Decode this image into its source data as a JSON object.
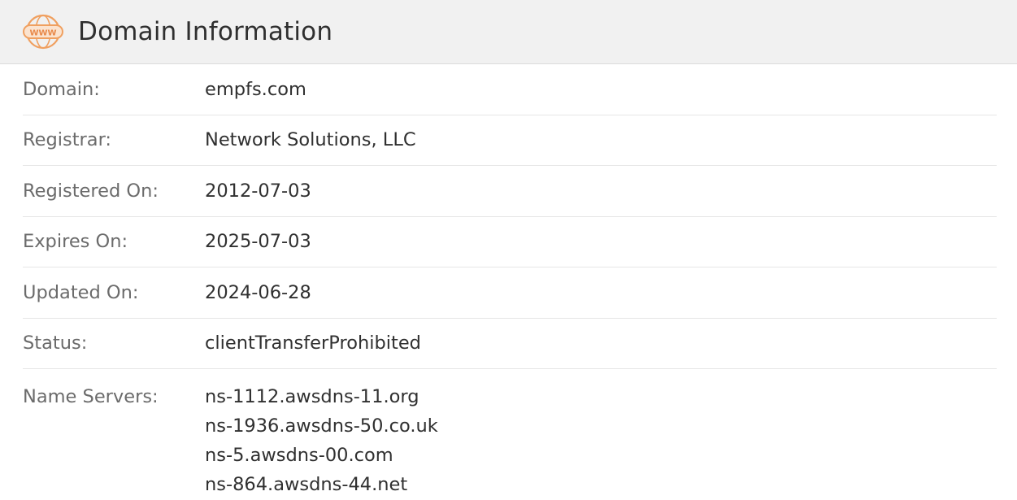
{
  "header": {
    "title": "Domain Information",
    "icon": "www-icon",
    "icon_text": "WWW",
    "icon_color": "#f0a060"
  },
  "fields": {
    "domain": {
      "label": "Domain:",
      "value": "empfs.com"
    },
    "registrar": {
      "label": "Registrar:",
      "value": "Network Solutions, LLC"
    },
    "registered_on": {
      "label": "Registered On:",
      "value": "2012-07-03"
    },
    "expires_on": {
      "label": "Expires On:",
      "value": "2025-07-03"
    },
    "updated_on": {
      "label": "Updated On:",
      "value": "2024-06-28"
    },
    "status": {
      "label": "Status:",
      "value": "clientTransferProhibited"
    },
    "name_servers": {
      "label": "Name Servers:",
      "values": [
        "ns-1112.awsdns-11.org",
        "ns-1936.awsdns-50.co.uk",
        "ns-5.awsdns-00.com",
        "ns-864.awsdns-44.net"
      ]
    }
  }
}
